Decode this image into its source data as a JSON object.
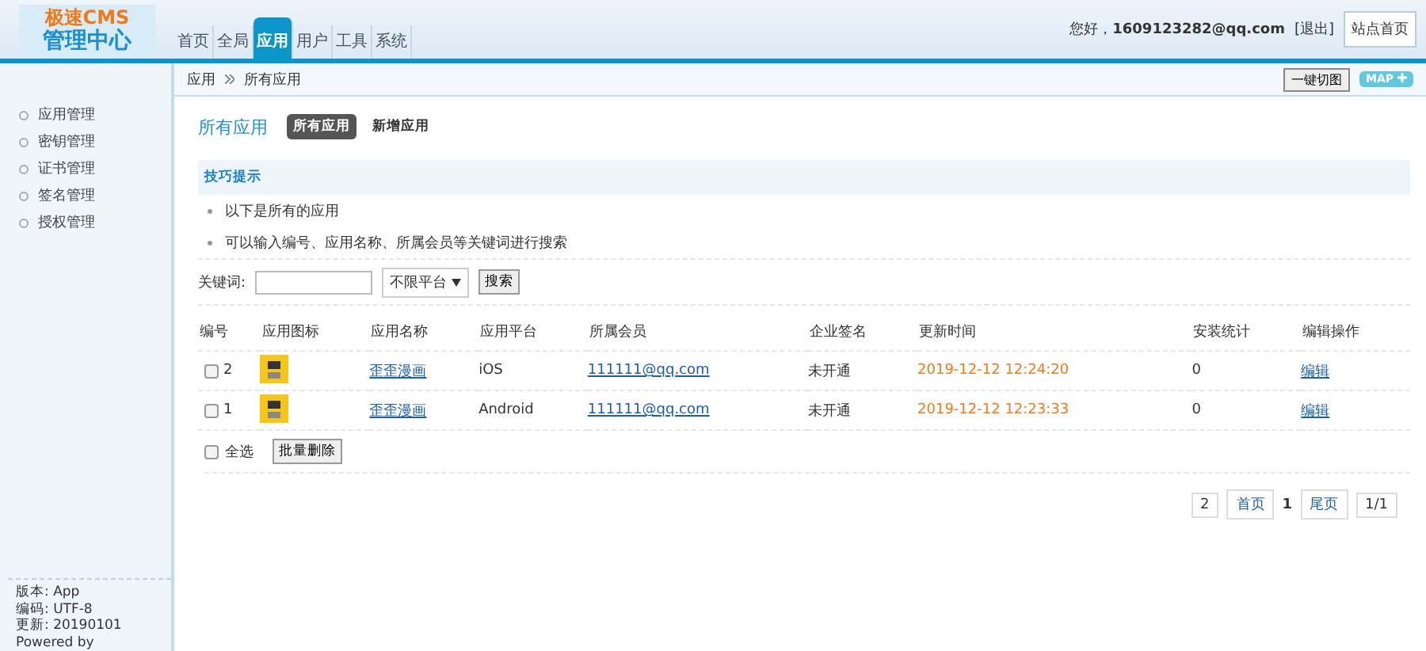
{
  "logo": {
    "line1": "极速CMS",
    "line2": "管理中心"
  },
  "nav": [
    {
      "label": "首页",
      "selected": false
    },
    {
      "label": "全局",
      "selected": false
    },
    {
      "label": "应用",
      "selected": true
    },
    {
      "label": "用户",
      "selected": false
    },
    {
      "label": "工具",
      "selected": false
    },
    {
      "label": "系统",
      "selected": false
    }
  ],
  "user": {
    "greeting": "您好，",
    "email": "1609123282@qq.com",
    "logout": "[退出]",
    "home": "站点首页"
  },
  "breadcrumb": [
    "应用",
    "所有应用"
  ],
  "toolbar": {
    "screenshot_button": "一键切图",
    "map_button": "MAP"
  },
  "sidebar": {
    "items": [
      "应用管理",
      "密钥管理",
      "证书管理",
      "签名管理",
      "授权管理"
    ],
    "footer": [
      "版本: App",
      "编码: UTF-8",
      "更新: 20190101",
      "Powered by"
    ]
  },
  "page_title": "所有应用",
  "subtabs": [
    {
      "label": "所有应用",
      "selected": true
    },
    {
      "label": "新增应用",
      "selected": false
    }
  ],
  "tips": {
    "title": "技巧提示",
    "items": [
      "以下是所有的应用",
      "可以输入编号、应用名称、所属会员等关键词进行搜索"
    ]
  },
  "search": {
    "label": "关键词:",
    "platform": "不限平台",
    "button": "搜索"
  },
  "table": {
    "columns": [
      "编号",
      "应用图标",
      "应用名称",
      "应用平台",
      "所属会员",
      "企业签名",
      "更新时间",
      "安装统计",
      "编辑操作"
    ],
    "rows": [
      {
        "checked": false,
        "id": "2",
        "name": "歪歪漫画",
        "platform": "iOS",
        "member": "111111@qq.com",
        "signature": "未开通",
        "time": "2019-12-12 12:24:20",
        "installs": "0",
        "action": "编辑"
      },
      {
        "checked": false,
        "id": "1",
        "name": "歪歪漫画",
        "platform": "Android",
        "member": "111111@qq.com",
        "signature": "未开通",
        "time": "2019-12-12 12:23:33",
        "installs": "0",
        "action": "编辑"
      }
    ]
  },
  "bulk": {
    "select_all": "全选",
    "select_all_checked": false,
    "delete_button": "批量删除"
  },
  "pagination": {
    "total": "2",
    "first": "首页",
    "current": "1",
    "last": "尾页",
    "pages": "1/1"
  }
}
